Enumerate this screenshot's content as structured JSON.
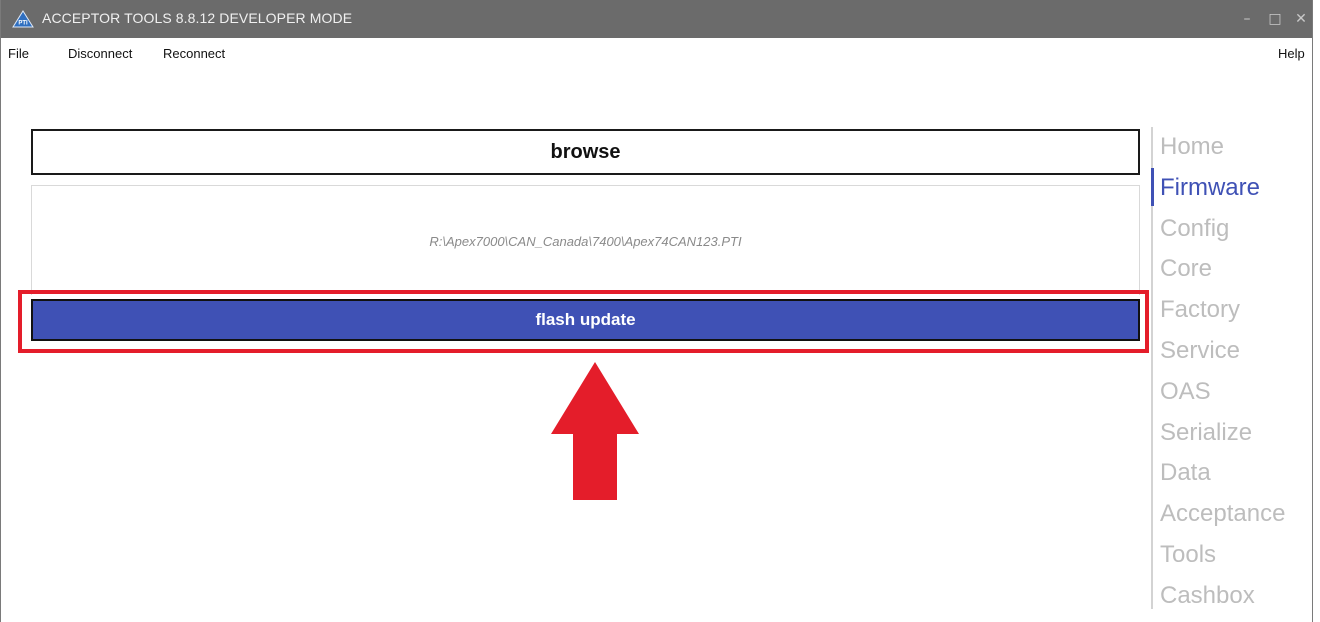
{
  "window": {
    "title": "ACCEPTOR TOOLS 8.8.12 DEVELOPER MODE",
    "logo_text": "PTI",
    "controls": {
      "minimize": "–",
      "maximize": "□",
      "close": "✕"
    }
  },
  "menu": {
    "file": "File",
    "disconnect": "Disconnect",
    "reconnect": "Reconnect",
    "help": "Help"
  },
  "main": {
    "browse_label": "browse",
    "file_path": "R:\\Apex7000\\CAN_Canada\\7400\\Apex74CAN123.PTI",
    "flash_label": "flash update"
  },
  "nav": {
    "items": [
      "Home",
      "Firmware",
      "Config",
      "Core",
      "Factory",
      "Service",
      "OAS",
      "Serialize",
      "Data",
      "Acceptance",
      "Tools",
      "Cashbox"
    ],
    "active": "Firmware"
  },
  "colors": {
    "accent": "#3f51b5",
    "annotation_red": "#e41d2a",
    "titlebar": "#6b6b6b",
    "nav_inactive": "#bdbdbd"
  }
}
